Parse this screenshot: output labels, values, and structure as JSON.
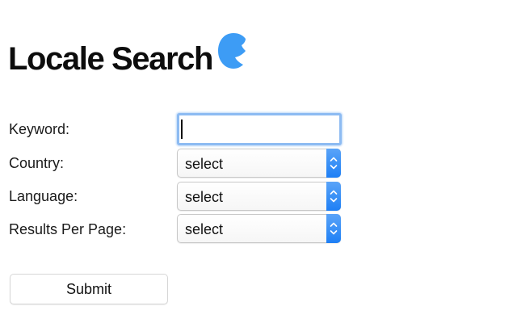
{
  "header": {
    "title": "Locale Search",
    "logo_icon": "locale-logo-icon",
    "logo_color": "#3d9cf5"
  },
  "form": {
    "keyword": {
      "label": "Keyword:",
      "value": "",
      "placeholder": ""
    },
    "country": {
      "label": "Country:",
      "selected": "select"
    },
    "language": {
      "label": "Language:",
      "selected": "select"
    },
    "results_per_page": {
      "label": "Results Per Page:",
      "selected": "select"
    },
    "submit_label": "Submit"
  },
  "colors": {
    "focus_ring": "#8dbbf2",
    "select_arrow": "#1e7ff5"
  }
}
